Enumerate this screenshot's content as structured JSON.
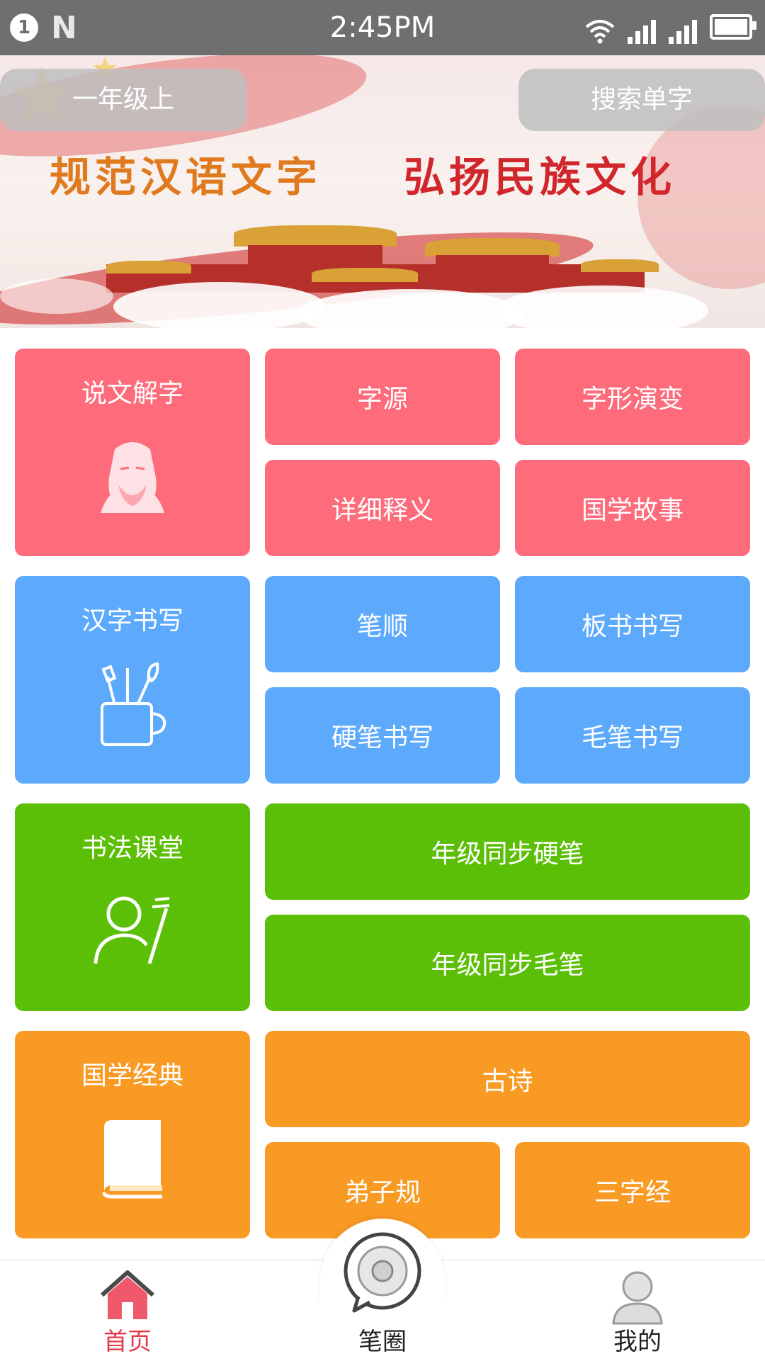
{
  "status_bar": {
    "time": "2:45PM",
    "notification_count": "1",
    "app_icon": "N"
  },
  "banner": {
    "grade_selector": "一年级上",
    "search": "搜索单字",
    "slogan_left": "规范汉语文字",
    "slogan_right": "弘扬民族文化"
  },
  "sections": [
    {
      "title": "说文解字",
      "icon": "sage-portrait-icon",
      "color": "#fe6b7b",
      "items": [
        "字源",
        "字形演变",
        "详细释义",
        "国学故事"
      ]
    },
    {
      "title": "汉字书写",
      "icon": "brush-pot-icon",
      "color": "#5daafc",
      "items": [
        "笔顺",
        "板书书写",
        "硬笔书写",
        "毛笔书写"
      ]
    },
    {
      "title": "书法课堂",
      "icon": "teacher-icon",
      "color": "#5cbf07",
      "items": [
        "年级同步硬笔",
        "年级同步毛笔"
      ]
    },
    {
      "title": "国学经典",
      "icon": "book-icon",
      "color": "#f99a24",
      "items": [
        "古诗",
        "弟子规",
        "三字经"
      ]
    }
  ],
  "nav": {
    "home": "首页",
    "pen_circle": "笔圈",
    "mine": "我的",
    "active_color": "#e8394a"
  }
}
